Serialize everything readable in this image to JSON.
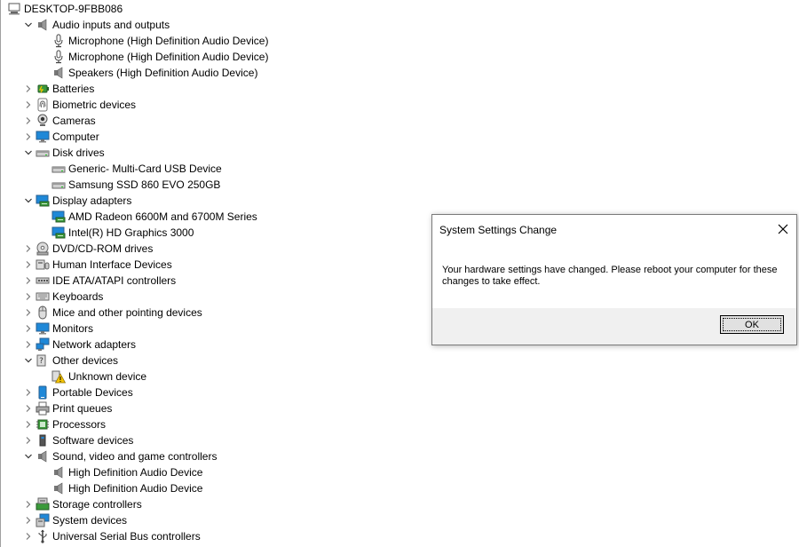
{
  "tree": [
    {
      "label": "DESKTOP-9FBB086",
      "level": 0,
      "expanded": true,
      "chevron": false,
      "icon": "computer-root-icon"
    },
    {
      "label": "Audio inputs and outputs",
      "level": 1,
      "chevron": "open",
      "icon": "speaker-icon"
    },
    {
      "label": "Microphone (High Definition Audio Device)",
      "level": 2,
      "chevron": false,
      "icon": "microphone-icon"
    },
    {
      "label": "Microphone (High Definition Audio Device)",
      "level": 2,
      "chevron": false,
      "icon": "microphone-icon"
    },
    {
      "label": "Speakers (High Definition Audio Device)",
      "level": 2,
      "chevron": false,
      "icon": "speaker-icon"
    },
    {
      "label": "Batteries",
      "level": 1,
      "chevron": "closed",
      "icon": "battery-icon"
    },
    {
      "label": "Biometric devices",
      "level": 1,
      "chevron": "closed",
      "icon": "fingerprint-icon"
    },
    {
      "label": "Cameras",
      "level": 1,
      "chevron": "closed",
      "icon": "camera-icon"
    },
    {
      "label": "Computer",
      "level": 1,
      "chevron": "closed",
      "icon": "monitor-icon"
    },
    {
      "label": "Disk drives",
      "level": 1,
      "chevron": "open",
      "icon": "disk-drive-icon"
    },
    {
      "label": "Generic- Multi-Card USB Device",
      "level": 2,
      "chevron": false,
      "icon": "disk-drive-icon"
    },
    {
      "label": "Samsung SSD 860 EVO 250GB",
      "level": 2,
      "chevron": false,
      "icon": "disk-drive-icon"
    },
    {
      "label": "Display adapters",
      "level": 1,
      "chevron": "open",
      "icon": "display-adapter-icon"
    },
    {
      "label": "AMD Radeon 6600M and 6700M Series",
      "level": 2,
      "chevron": false,
      "icon": "display-adapter-icon"
    },
    {
      "label": "Intel(R) HD Graphics 3000",
      "level": 2,
      "chevron": false,
      "icon": "display-adapter-icon"
    },
    {
      "label": "DVD/CD-ROM drives",
      "level": 1,
      "chevron": "closed",
      "icon": "dvd-drive-icon"
    },
    {
      "label": "Human Interface Devices",
      "level": 1,
      "chevron": "closed",
      "icon": "hid-icon"
    },
    {
      "label": "IDE ATA/ATAPI controllers",
      "level": 1,
      "chevron": "closed",
      "icon": "ide-controller-icon"
    },
    {
      "label": "Keyboards",
      "level": 1,
      "chevron": "closed",
      "icon": "keyboard-icon"
    },
    {
      "label": "Mice and other pointing devices",
      "level": 1,
      "chevron": "closed",
      "icon": "mouse-icon"
    },
    {
      "label": "Monitors",
      "level": 1,
      "chevron": "closed",
      "icon": "monitor-icon"
    },
    {
      "label": "Network adapters",
      "level": 1,
      "chevron": "closed",
      "icon": "network-adapter-icon"
    },
    {
      "label": "Other devices",
      "level": 1,
      "chevron": "open",
      "icon": "other-devices-icon"
    },
    {
      "label": "Unknown device",
      "level": 2,
      "chevron": false,
      "icon": "unknown-device-warning-icon"
    },
    {
      "label": "Portable Devices",
      "level": 1,
      "chevron": "closed",
      "icon": "portable-device-icon"
    },
    {
      "label": "Print queues",
      "level": 1,
      "chevron": "closed",
      "icon": "printer-icon"
    },
    {
      "label": "Processors",
      "level": 1,
      "chevron": "closed",
      "icon": "processor-icon"
    },
    {
      "label": "Software devices",
      "level": 1,
      "chevron": "closed",
      "icon": "software-device-icon"
    },
    {
      "label": "Sound, video and game controllers",
      "level": 1,
      "chevron": "open",
      "icon": "speaker-icon"
    },
    {
      "label": "High Definition Audio Device",
      "level": 2,
      "chevron": false,
      "icon": "speaker-icon"
    },
    {
      "label": "High Definition Audio Device",
      "level": 2,
      "chevron": false,
      "icon": "speaker-icon"
    },
    {
      "label": "Storage controllers",
      "level": 1,
      "chevron": "closed",
      "icon": "storage-controller-icon"
    },
    {
      "label": "System devices",
      "level": 1,
      "chevron": "closed",
      "icon": "system-device-icon"
    },
    {
      "label": "Universal Serial Bus controllers",
      "level": 1,
      "chevron": "closed",
      "icon": "usb-icon"
    }
  ],
  "dialog": {
    "title": "System Settings Change",
    "message": "Your hardware settings have changed. Please reboot your computer for these changes to take effect.",
    "ok_label": "OK",
    "close_icon": "close-icon"
  },
  "colors": {
    "dialog_border": "#7a7a7a",
    "footer_bg": "#f0f0f0",
    "button_bg": "#e1e1e1",
    "monitor_blue": "#1e88d8",
    "warning_yellow": "#f5c400"
  }
}
